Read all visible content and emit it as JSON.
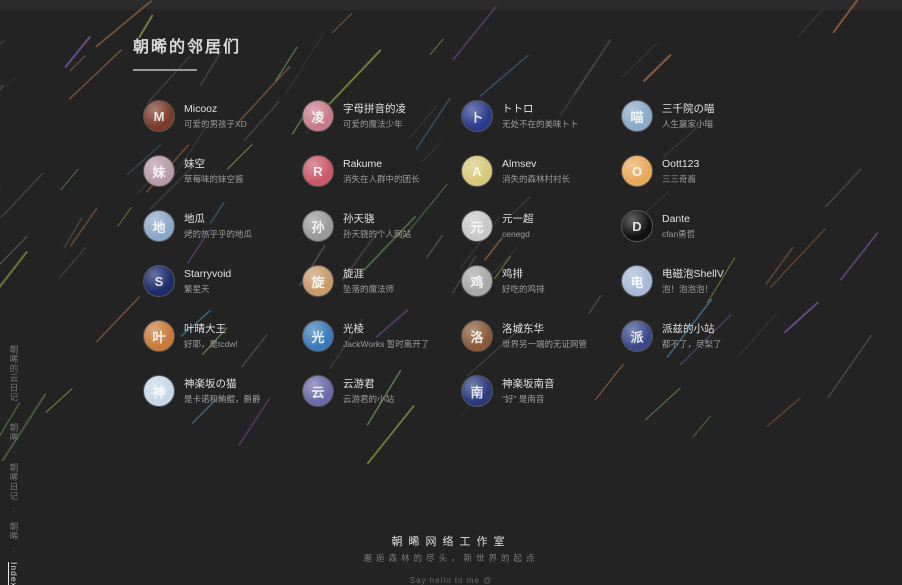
{
  "page": {
    "title": "朝晞的邻居们"
  },
  "friends": [
    {
      "name": "Micooz",
      "desc": "可爱的男孩子XD",
      "avatar": "M",
      "color": "#7a3a2a"
    },
    {
      "name": "字母拼音的凌",
      "desc": "可爱的魔法少年",
      "avatar": "凌",
      "color": "#c87a8a"
    },
    {
      "name": "トトロ",
      "desc": "无处不在的美味トト",
      "avatar": "ト",
      "color": "#2a3a8a"
    },
    {
      "name": "三千院の喵",
      "desc": "人生赢家小喵",
      "avatar": "喵",
      "color": "#8aaac8"
    },
    {
      "name": "妹空",
      "desc": "草莓味的妹空酱",
      "avatar": "妹",
      "color": "#b89aa8"
    },
    {
      "name": "Rakume",
      "desc": "消失在人群中的团长",
      "avatar": "R",
      "color": "#c85a6a"
    },
    {
      "name": "Almsev",
      "desc": "消失的森林村村长",
      "avatar": "A",
      "color": "#d8c87a"
    },
    {
      "name": "Oott123",
      "desc": "三三奇酱",
      "avatar": "O",
      "color": "#e8a85a"
    },
    {
      "name": "地瓜",
      "desc": "烤的热乎乎的地瓜",
      "avatar": "地",
      "color": "#8aa8c8"
    },
    {
      "name": "孙天骁",
      "desc": "孙天骁的个人网站",
      "avatar": "孙",
      "color": "#9a9a9a"
    },
    {
      "name": "元一超",
      "desc": "cenegd",
      "avatar": "元",
      "color": "#c8c8c8"
    },
    {
      "name": "Dante",
      "desc": "cfan勇哲",
      "avatar": "D",
      "color": "#111111"
    },
    {
      "name": "Starryvoid",
      "desc": "繁星天",
      "avatar": "S",
      "color": "#1a2a6a"
    },
    {
      "name": "旋涯",
      "desc": "坠落的魔法师",
      "avatar": "旋",
      "color": "#c89a6a"
    },
    {
      "name": "鸡排",
      "desc": "好吃的鸡排",
      "avatar": "鸡",
      "color": "#a8a8a8"
    },
    {
      "name": "电磁泡ShellV",
      "desc": "泡！泡泡泡！",
      "avatar": "电",
      "color": "#a8b8d8"
    },
    {
      "name": "叶晴大王",
      "desc": "好耶，是tcdw!",
      "avatar": "叶",
      "color": "#c87a3a"
    },
    {
      "name": "光棱",
      "desc": "JackWorks 暂时离开了",
      "avatar": "光",
      "color": "#3a7ab8"
    },
    {
      "name": "洛城东华",
      "desc": "世界另一端的无证网管",
      "avatar": "洛",
      "color": "#8a5a3a"
    },
    {
      "name": "派兹的小站",
      "desc": "都不了，尽梨了",
      "avatar": "派",
      "color": "#3a4a8a"
    },
    {
      "name": "神楽坂の猫",
      "desc": "是卡诺和鲔鲲，爵爵",
      "avatar": "神",
      "color": "#c8d8e8"
    },
    {
      "name": "云游君",
      "desc": "云游君的小站",
      "avatar": "云",
      "color": "#6a6aa8"
    },
    {
      "name": "神楽坂南音",
      "desc": "\"好\" 是南音",
      "avatar": "南",
      "color": "#2a3a7a"
    }
  ],
  "footer": {
    "title": "朝晞网络工作室",
    "subtitle": "邂逅森林的尽头，新世界的起点",
    "hello": "Say hello to me @"
  },
  "side_nav": {
    "items": [
      "朝晞的云日记",
      "朝晞",
      "朝晞日记",
      "朝晞",
      "Index"
    ],
    "separator": "·",
    "active": "Index"
  }
}
